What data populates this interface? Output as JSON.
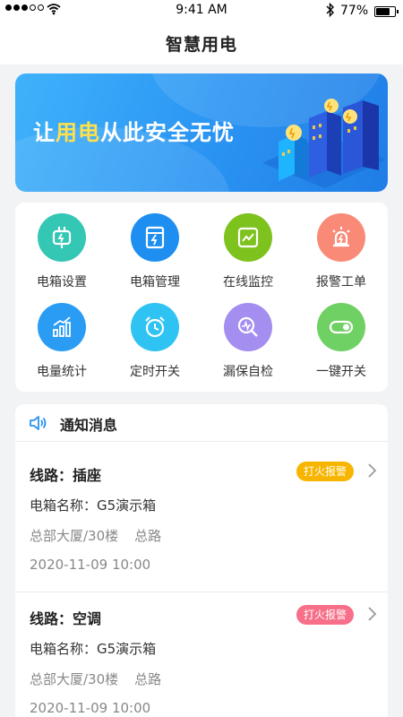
{
  "status_bar": {
    "time": "9:41 AM",
    "battery": "77%",
    "battery_level": 0.77
  },
  "nav": {
    "title": "智慧用电"
  },
  "banner": {
    "slogan_prefix": "让",
    "slogan_highlight": "用电",
    "slogan_suffix": "从此安全无忧"
  },
  "menu": [
    {
      "label": "电箱设置",
      "icon": "plug-icon",
      "color": "#33c7b4"
    },
    {
      "label": "电箱管理",
      "icon": "electric-box-icon",
      "color": "#1e8ff0"
    },
    {
      "label": "在线监控",
      "icon": "monitor-chart-icon",
      "color": "#7ec21e"
    },
    {
      "label": "报警工单",
      "icon": "alarm-light-icon",
      "color": "#f98a77"
    },
    {
      "label": "电量统计",
      "icon": "bar-chart-icon",
      "color": "#2a9cf4"
    },
    {
      "label": "定时开关",
      "icon": "alarm-clock-icon",
      "color": "#2ec3f2"
    },
    {
      "label": "漏保自检",
      "icon": "search-wave-icon",
      "color": "#a48ef0"
    },
    {
      "label": "一键开关",
      "icon": "toggle-icon",
      "color": "#6fd063"
    }
  ],
  "notice": {
    "title": "通知消息",
    "items": [
      {
        "line": "线路：插座",
        "badge": "打火报警",
        "badge_color": "#f7b500",
        "box": "电箱名称：G5演示箱",
        "building": "总部大厦/30楼",
        "branch": "总路",
        "time": "2020-11-09  10:00"
      },
      {
        "line": "线路：空调",
        "badge": "打火报警",
        "badge_color": "#f76f89",
        "box": "电箱名称：G5演示箱",
        "building": "总部大厦/30楼",
        "branch": "总路",
        "time": "2020-11-09  10:00"
      }
    ]
  }
}
